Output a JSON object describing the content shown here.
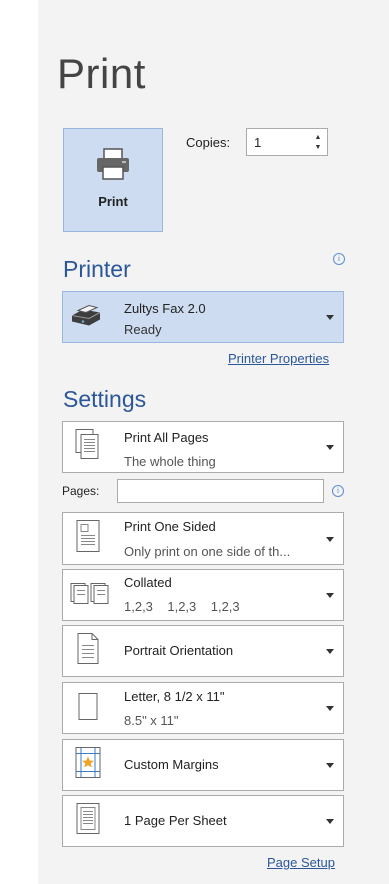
{
  "title": "Print",
  "print_button": {
    "label": "Print"
  },
  "copies": {
    "label": "Copies:",
    "value": "1"
  },
  "printer": {
    "heading": "Printer",
    "name": "Zultys Fax 2.0",
    "status": "Ready",
    "properties_link": "Printer Properties"
  },
  "settings": {
    "heading": "Settings",
    "pages_label": "Pages:",
    "pages_value": "",
    "items": [
      {
        "line1": "Print All Pages",
        "line2": "The whole thing",
        "icon": "pages-icon"
      },
      {
        "line1": "Print One Sided",
        "line2": "Only print on one side of th...",
        "icon": "one-sided-icon"
      },
      {
        "line1": "Collated",
        "line2": "1,2,3    1,2,3    1,2,3",
        "icon": "collated-icon"
      },
      {
        "line1": "Portrait Orientation",
        "line2": "",
        "icon": "portrait-icon"
      },
      {
        "line1": "Letter, 8 1/2 x 11\"",
        "line2": "8.5\" x 11\"",
        "icon": "paper-size-icon"
      },
      {
        "line1": "Custom Margins",
        "line2": "",
        "icon": "margins-icon"
      },
      {
        "line1": "1 Page Per Sheet",
        "line2": "",
        "icon": "pages-per-sheet-icon"
      }
    ],
    "page_setup_link": "Page Setup"
  }
}
